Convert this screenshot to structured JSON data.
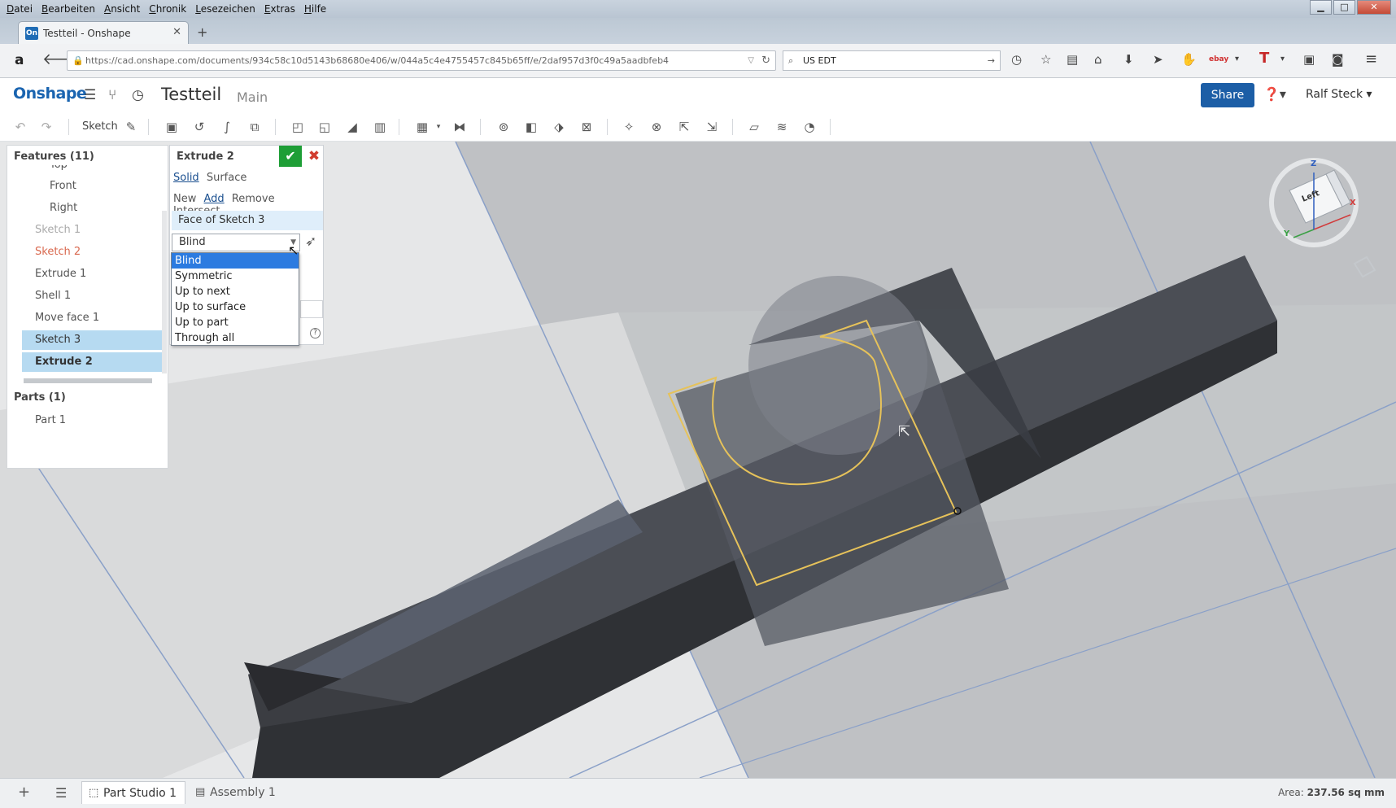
{
  "menubar": {
    "items": [
      "Datei",
      "Bearbeiten",
      "Ansicht",
      "Chronik",
      "Lesezeichen",
      "Extras",
      "Hilfe"
    ]
  },
  "browser": {
    "tab_title": "Testteil - Onshape",
    "tab_favicon": "On",
    "url": "https://cad.onshape.com/documents/934c58c10d5143b68680e406/w/044a5c4e4755457c845b65ff/e/2daf957d3f0c49a5aadbfeb4",
    "search_value": "US EDT"
  },
  "app": {
    "logo": "Onshape",
    "document_title": "Testteil",
    "workspace": "Main",
    "share_label": "Share",
    "user_name": "Ralf Steck",
    "sketch_label": "Sketch",
    "accent_color": "#1c5ea6"
  },
  "feature_panel": {
    "features_header": "Features (11)",
    "items": [
      {
        "label": "Top",
        "state": "indent"
      },
      {
        "label": "Front",
        "state": "indent"
      },
      {
        "label": "Right",
        "state": "indent"
      },
      {
        "label": "Sketch 1",
        "state": "dim"
      },
      {
        "label": "Sketch 2",
        "state": "red"
      },
      {
        "label": "Extrude 1",
        "state": "normal"
      },
      {
        "label": "Shell 1",
        "state": "normal"
      },
      {
        "label": "Move face 1",
        "state": "normal"
      },
      {
        "label": "Sketch 3",
        "state": "selected"
      },
      {
        "label": "Extrude 2",
        "state": "selected-bold"
      }
    ],
    "parts_header": "Parts (1)",
    "parts": [
      "Part 1"
    ]
  },
  "extrude_dialog": {
    "title": "Extrude 2",
    "body_types": [
      "Solid",
      "Surface"
    ],
    "body_type_active": "Solid",
    "operations": [
      "New",
      "Add",
      "Remove",
      "Intersect"
    ],
    "operation_active": "Add",
    "faces_value": "Face of Sketch 3",
    "end_type_value": "Blind",
    "end_type_options": [
      "Blind",
      "Symmetric",
      "Up to next",
      "Up to surface",
      "Up to part",
      "Through all"
    ],
    "end_type_highlighted": "Blind"
  },
  "view_cube": {
    "face_label": "Left",
    "axis_x": "X",
    "axis_y": "Y",
    "axis_z": "Z"
  },
  "bottom_bar": {
    "tabs": [
      "Part Studio 1",
      "Assembly 1"
    ],
    "active_tab": "Part Studio 1",
    "area_label": "Area:",
    "area_value": "237.56 sq mm"
  }
}
